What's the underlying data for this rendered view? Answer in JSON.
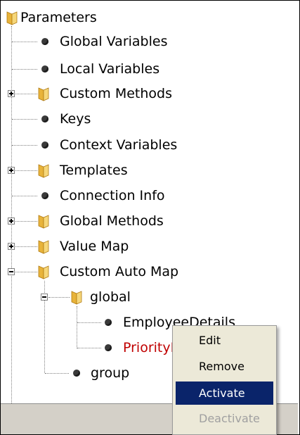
{
  "tree": {
    "root": {
      "label": "Parameters",
      "icon": "folder-icon"
    },
    "items": [
      {
        "label": "Global Variables",
        "icon": "bullet-icon"
      },
      {
        "label": "Local Variables",
        "icon": "bullet-icon"
      },
      {
        "label": "Custom Methods",
        "icon": "folder-icon",
        "expander": "plus"
      },
      {
        "label": "Keys",
        "icon": "bullet-icon"
      },
      {
        "label": "Context Variables",
        "icon": "bullet-icon"
      },
      {
        "label": "Templates",
        "icon": "folder-icon",
        "expander": "plus"
      },
      {
        "label": "Connection Info",
        "icon": "bullet-icon"
      },
      {
        "label": "Global Methods",
        "icon": "folder-icon",
        "expander": "plus"
      },
      {
        "label": "Value Map",
        "icon": "folder-icon",
        "expander": "plus"
      },
      {
        "label": "Custom Auto Map",
        "icon": "folder-icon",
        "expander": "minus",
        "children": [
          {
            "label": "global",
            "icon": "folder-icon",
            "expander": "minus",
            "children": [
              {
                "label": "EmployeeDetails",
                "icon": "bullet-icon",
                "visible_text": "Employe"
              },
              {
                "label": "PriorityM",
                "icon": "bullet-icon",
                "color": "#c00000"
              }
            ]
          },
          {
            "label": "group",
            "icon": "bullet-icon"
          }
        ]
      }
    ]
  },
  "context_menu": {
    "items": [
      {
        "label": "Edit",
        "state": "normal"
      },
      {
        "label": "Remove",
        "state": "normal"
      },
      {
        "label": "Activate",
        "state": "highlighted"
      },
      {
        "label": "Deactivate",
        "state": "disabled"
      }
    ]
  },
  "colors": {
    "highlight": "#0a246a",
    "inactive_item_text": "#c00000",
    "disabled_text": "#a0a0a0",
    "menu_bg": "#ece9d8",
    "statusbar_bg": "#d4d0c8"
  }
}
